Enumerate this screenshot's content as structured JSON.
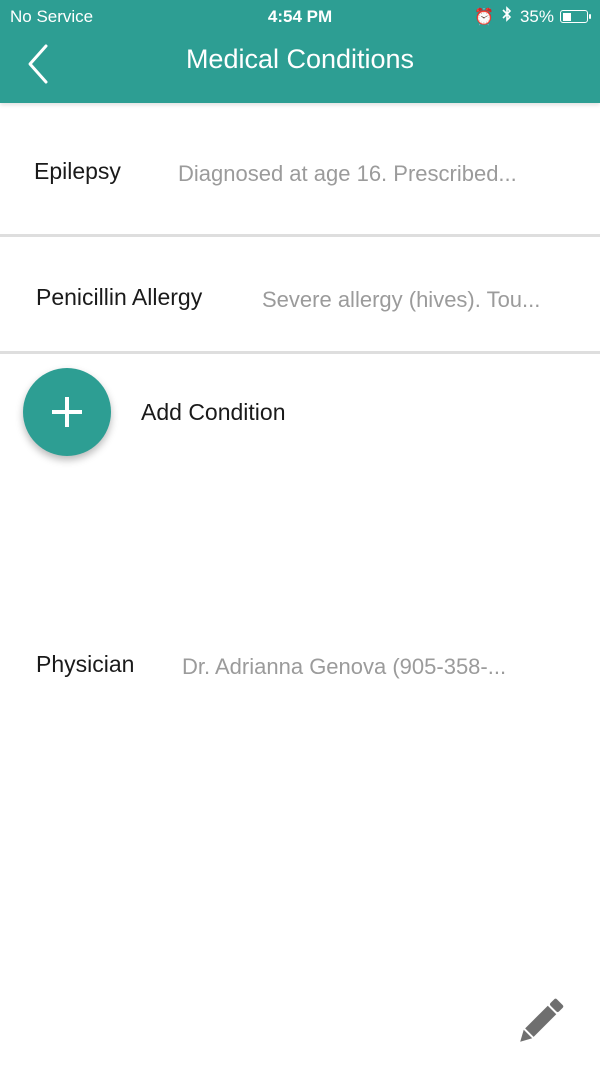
{
  "status_bar": {
    "carrier": "No Service",
    "time": "4:54 PM",
    "battery": "35%",
    "battery_level": 0.35
  },
  "header": {
    "title": "Medical Conditions",
    "back_icon": "chevron-left-icon"
  },
  "conditions": [
    {
      "label": "Epilepsy",
      "value": "Diagnosed at age 16. Prescribed..."
    },
    {
      "label": "Penicillin Allergy",
      "value": "Severe allergy (hives). Tou..."
    }
  ],
  "add_condition": {
    "label": "Add Condition",
    "icon": "plus-icon"
  },
  "physician": {
    "label": "Physician",
    "value": "Dr. Adrianna Genova (905-358-..."
  },
  "edit": {
    "icon": "pencil-icon"
  },
  "colors": {
    "accent": "#2d9e93",
    "secondary_text": "#9b9b9b",
    "primary_text": "#1a1a1a",
    "divider": "#dedede"
  }
}
